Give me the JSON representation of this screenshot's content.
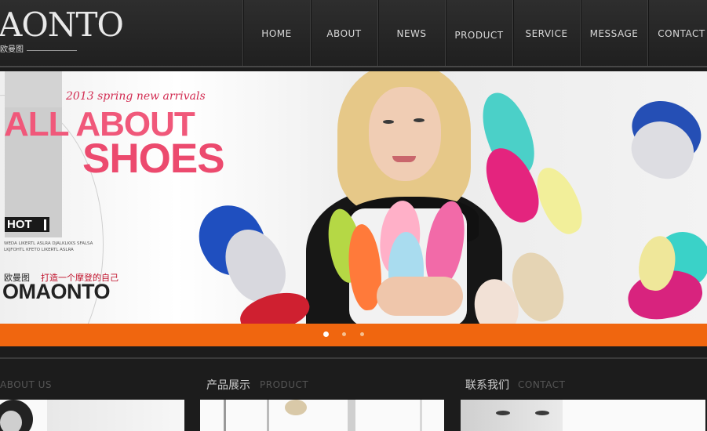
{
  "header": {
    "logo_text": "AONTO",
    "logo_sub": "欧曼图"
  },
  "nav": {
    "items": [
      {
        "label": "HOME"
      },
      {
        "label": "ABOUT"
      },
      {
        "label": "NEWS"
      },
      {
        "label": "PRODUCT"
      },
      {
        "label": "SERVICE"
      },
      {
        "label": "MESSAGE"
      },
      {
        "label": "CONTACT"
      }
    ]
  },
  "banner": {
    "tagline": "2013 spring new arrivals",
    "headline_1": "ALL ABOUT",
    "headline_2": "SHOES",
    "badge": "HOT",
    "small_text": "WEDA LIKERTL ASLRA DJALKLKKS SFALSA LKJFOHTL KFETO LIKERTL ASLRA",
    "brand_cn": "欧曼图",
    "slogan": "打造一个摩登的自己",
    "brand_en": "OMAONTO"
  },
  "slider": {
    "dots": 3,
    "active_index": 0
  },
  "sections": {
    "about": {
      "en": "ABOUT US"
    },
    "product": {
      "cn": "产品展示",
      "en": "PRODUCT"
    },
    "contact": {
      "cn": "联系我们",
      "en": "CONTACT"
    }
  },
  "colors": {
    "accent_orange": "#f0660f",
    "headline_pink": "#f0587a",
    "slogan_red": "#c0102a",
    "header_bg": "#262626"
  }
}
